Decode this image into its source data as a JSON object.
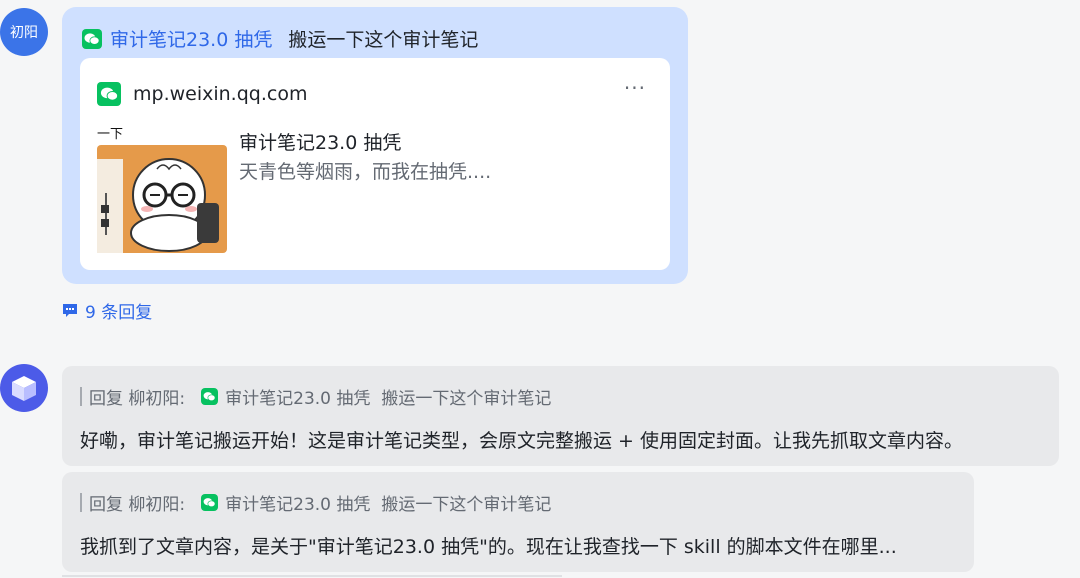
{
  "user_message": {
    "avatar_text": "初阳",
    "link_title": "审计笔记23.0 抽凭",
    "text": "搬运一下这个审计笔记",
    "card": {
      "domain": "mp.weixin.qq.com",
      "more": "···",
      "title": "审计笔记23.0 抽凭",
      "description": "天青色等烟雨，而我在抽凭....",
      "thumb_caption": "一下"
    },
    "reply_count": "9 条回复"
  },
  "bot_messages": [
    {
      "quote_prefix": "回复 柳初阳:",
      "quote_link": "审计笔记23.0 抽凭",
      "quote_text": "搬运一下这个审计笔记",
      "text": "好嘞，审计笔记搬运开始！这是审计笔记类型，会原文完整搬运 + 使用固定封面。让我先抓取文章内容。"
    },
    {
      "quote_prefix": "回复 柳初阳:",
      "quote_link": "审计笔记23.0 抽凭",
      "quote_text": "搬运一下这个审计笔记",
      "text": "我抓到了文章内容，是关于\"审计笔记23.0 抽凭\"的。现在让我查找一下 skill 的脚本文件在哪里..."
    }
  ],
  "colors": {
    "link_blue": "#2f68e8",
    "wechat_green": "#07c160",
    "user_bubble": "#cfe0ff",
    "bot_bubble": "#e8e9eb"
  }
}
